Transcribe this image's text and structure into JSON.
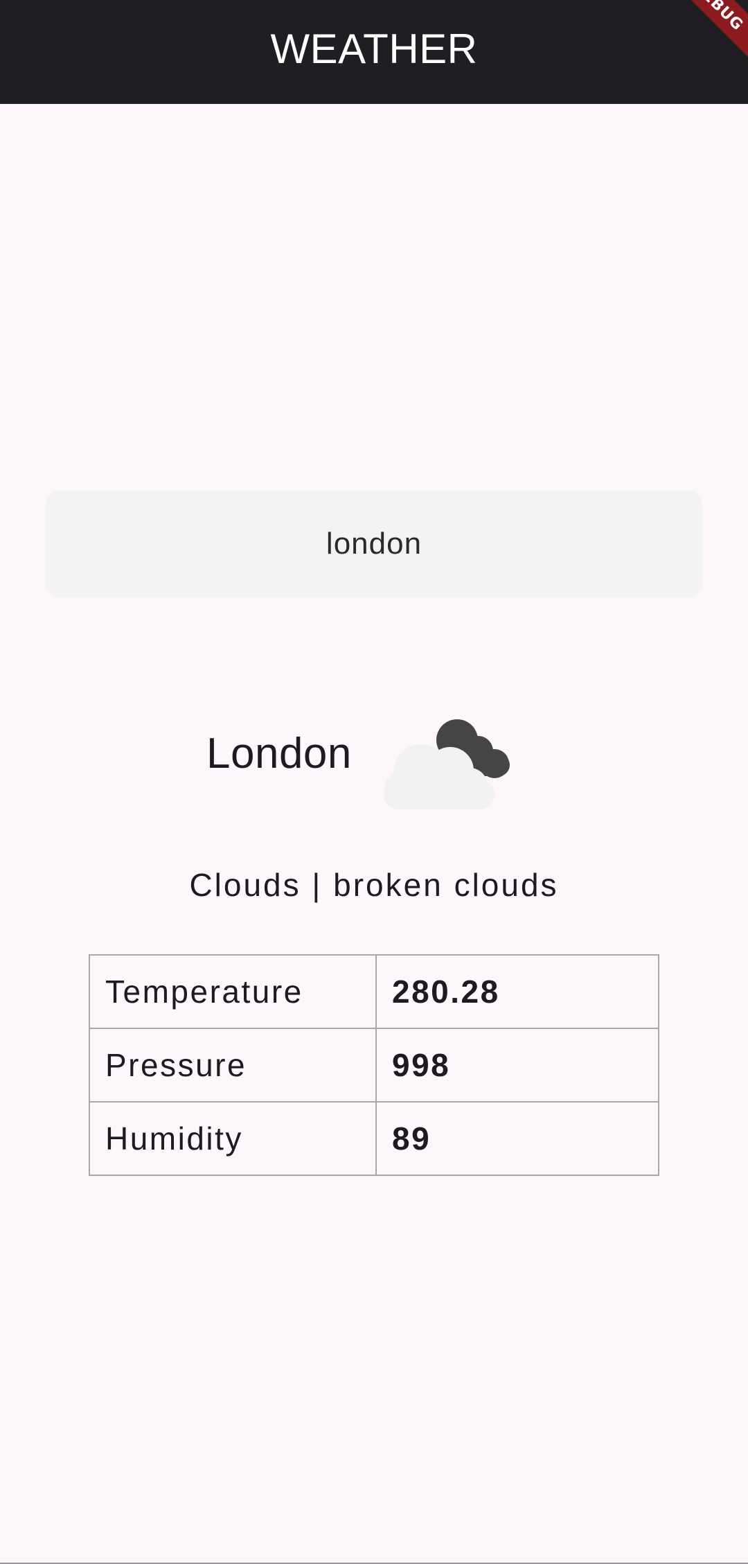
{
  "app_bar": {
    "title": "WEATHER",
    "debug_banner": "DEBUG"
  },
  "search": {
    "value": "london",
    "placeholder": ""
  },
  "weather": {
    "city": "London",
    "icon": "broken-clouds-icon",
    "description": "Clouds | broken clouds"
  },
  "details": {
    "rows": [
      {
        "label": "Temperature",
        "value": "280.28"
      },
      {
        "label": "Pressure",
        "value": "998"
      },
      {
        "label": "Humidity",
        "value": "89"
      }
    ]
  },
  "colors": {
    "app_bar": "#1f1e22",
    "background": "#fdf7fc",
    "debug_banner": "#8b1b1f",
    "search_fill": "#f3f3f3",
    "table_border": "#a8a8a8"
  }
}
